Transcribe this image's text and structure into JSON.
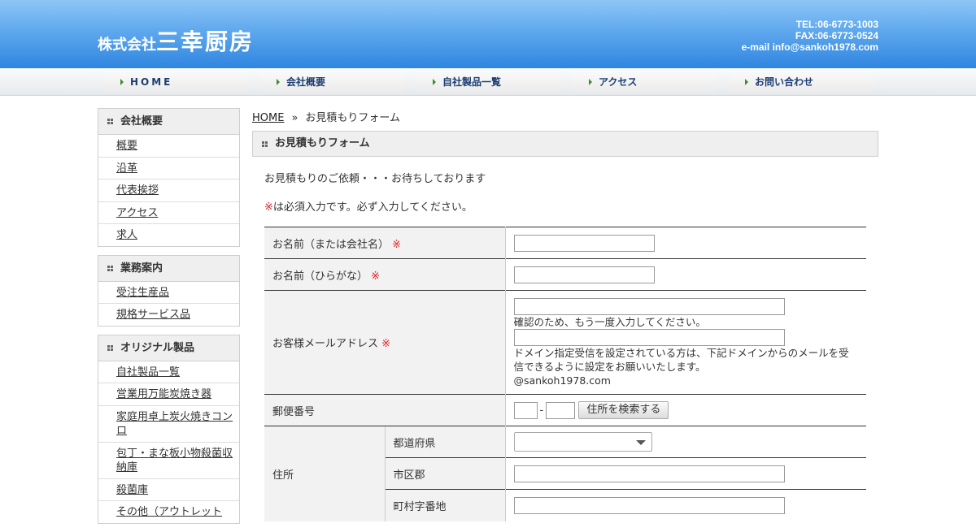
{
  "header": {
    "logo_small": "株式会社",
    "logo_big": "三幸厨房",
    "tel": "TEL:06-6773-1003",
    "fax": "FAX:06-6773-0524",
    "email": "e-mail info@sankoh1978.com"
  },
  "nav": [
    "HOME",
    "会社概要",
    "自社製品一覧",
    "アクセス",
    "お問い合わせ"
  ],
  "sidebar": [
    {
      "title": "会社概要",
      "items": [
        "概要",
        "沿革",
        "代表挨拶",
        "アクセス",
        "求人"
      ]
    },
    {
      "title": "業務案内",
      "items": [
        "受注生産品",
        "規格サービス品"
      ]
    },
    {
      "title": "オリジナル製品",
      "items": [
        "自社製品一覧",
        "営業用万能炭焼き器",
        "家庭用卓上炭火焼きコンロ",
        "包丁・まな板小物殺菌収納庫",
        "殺菌庫",
        "その他（アウトレット"
      ]
    }
  ],
  "breadcrumb": {
    "home": "HOME",
    "sep": "»",
    "current": "お見積もりフォーム"
  },
  "page_title": "お見積もりフォーム",
  "intro": "お見積もりのご依頼・・・お待ちしております",
  "required_note": {
    "mark": "※",
    "text": "は必須入力です。必ず入力してください。"
  },
  "form": {
    "required_mark": "※",
    "name_label": "お名前（または会社名）",
    "kana_label": "お名前（ひらがな）",
    "email_label": "お客様メールアドレス",
    "email_confirm_note": "確認のため、もう一度入力してください。",
    "email_domain_note": "ドメイン指定受信を設定されている方は、下記ドメインからのメールを受信できるように設定をお願いいたします。",
    "email_domain": "@sankoh1978.com",
    "postal_label": "郵便番号",
    "postal_dash": "-",
    "postal_button": "住所を検索する",
    "address_label": "住所",
    "prefecture_label": "都道府県",
    "prefecture_value": "",
    "city_label": "市区郡",
    "town_label": "町村字番地"
  }
}
